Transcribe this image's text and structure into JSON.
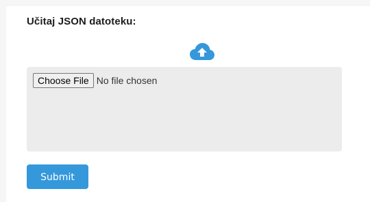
{
  "form": {
    "title": "Učitaj JSON datoteku:",
    "upload_icon": "cloud-upload-icon",
    "file_input": {
      "button_label": "Choose File",
      "status": "No file chosen"
    },
    "submit_label": "Submit"
  },
  "colors": {
    "accent": "#3498db",
    "dropzone_bg": "#ececec",
    "page_bg": "#f6f6f6"
  }
}
